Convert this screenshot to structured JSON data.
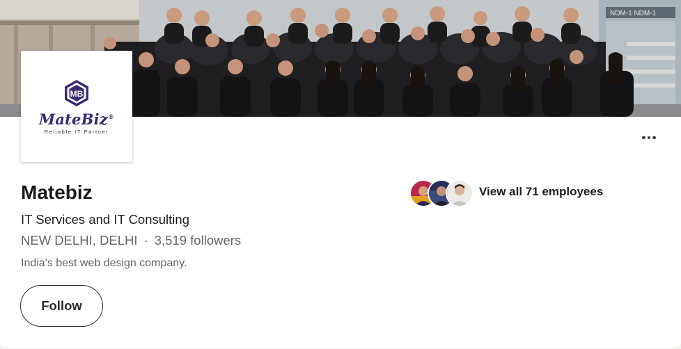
{
  "company": {
    "name": "Matebiz",
    "industry": "IT Services and IT Consulting",
    "location": "NEW DELHI, DELHI",
    "separator": "·",
    "followers": "3,519 followers",
    "tagline": "India's best web design company."
  },
  "logo": {
    "monogram": "MB",
    "brand": "MateBiz",
    "registered_mark": "®",
    "tagline": "Reliable IT Partner"
  },
  "actions": {
    "follow_label": "Follow",
    "more_icon": "more-horizontal-icon"
  },
  "employees": {
    "label": "View all 71 employees",
    "avatar_count": 3
  },
  "cover_signage": {
    "building_sign": "NDM-1 NDM-1"
  },
  "colors": {
    "logo_purple": "#3b2a73",
    "text_primary": "#1a1a1a",
    "text_secondary": "#666666",
    "button_border": "#2b2b2b",
    "background": "#f4f2ee"
  }
}
